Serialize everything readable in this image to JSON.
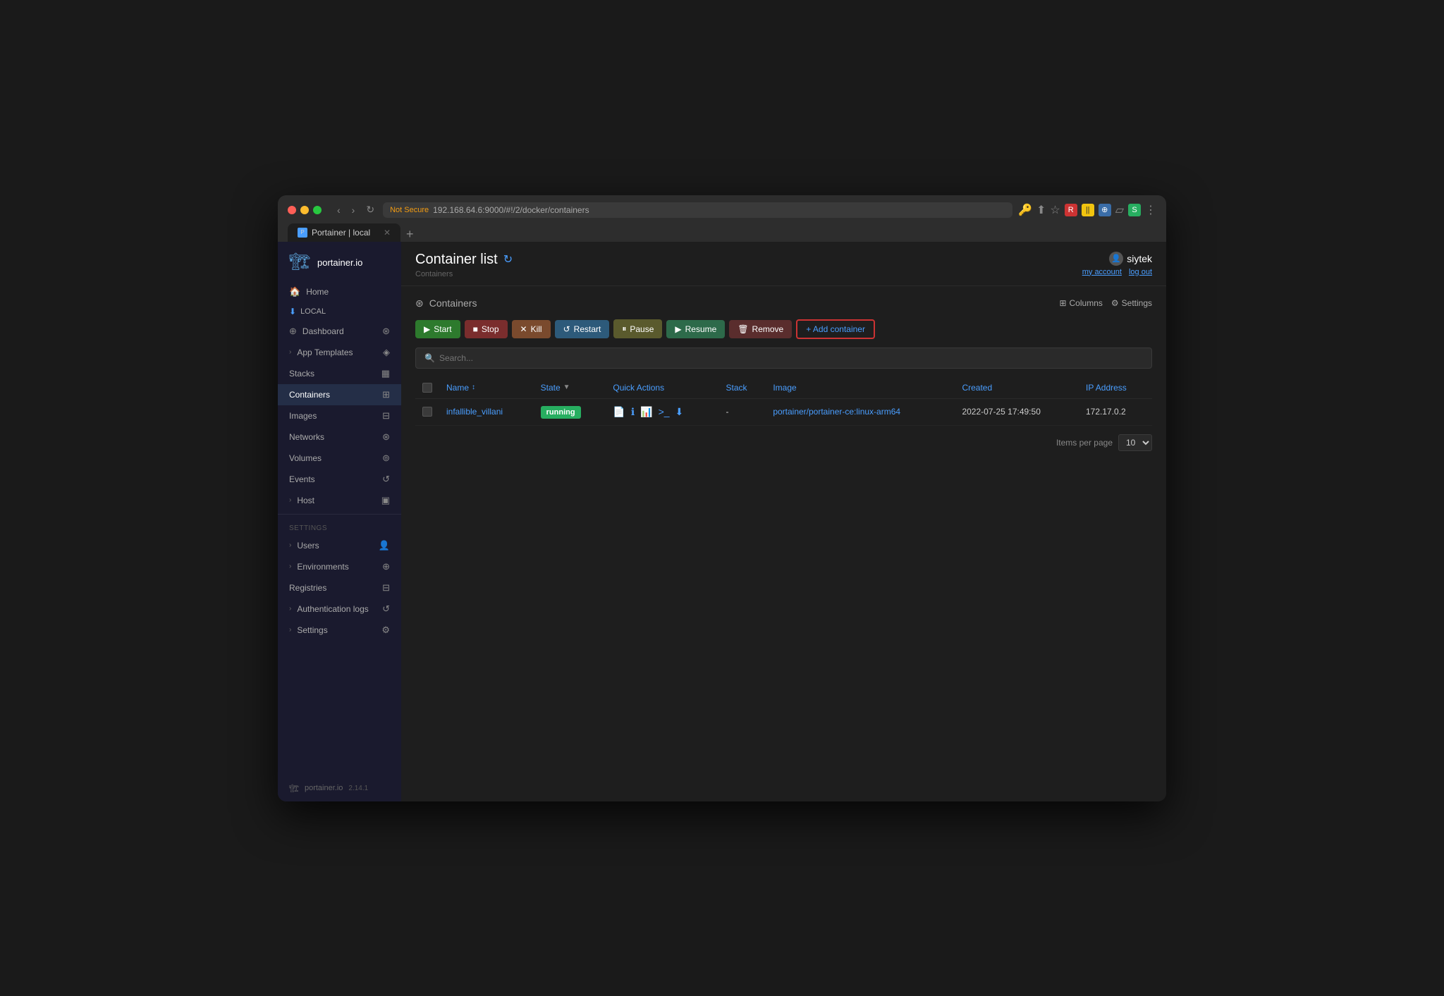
{
  "browser": {
    "tab_title": "Portainer | local",
    "tab_icon": "P",
    "url": "192.168.64.6:9000/#!/2/docker/containers",
    "url_full": "192.168.64.6:9000/#!/2/docker/containers",
    "security_warning": "Not Secure",
    "new_tab_label": "+"
  },
  "sidebar": {
    "logo_text": "portainer.io",
    "home_label": "Home",
    "local_label": "LOCAL",
    "nav_items": [
      {
        "id": "dashboard",
        "label": "Dashboard",
        "icon": "⊕"
      },
      {
        "id": "app-templates",
        "label": "App Templates",
        "icon": "◈",
        "has_chevron": true
      },
      {
        "id": "stacks",
        "label": "Stacks",
        "icon": "▦"
      },
      {
        "id": "containers",
        "label": "Containers",
        "icon": "⊞",
        "active": true
      },
      {
        "id": "images",
        "label": "Images",
        "icon": "⊟"
      },
      {
        "id": "networks",
        "label": "Networks",
        "icon": "⊛"
      },
      {
        "id": "volumes",
        "label": "Volumes",
        "icon": "⊚"
      },
      {
        "id": "events",
        "label": "Events",
        "icon": "↺"
      },
      {
        "id": "host",
        "label": "Host",
        "icon": "▣",
        "has_chevron": true
      }
    ],
    "settings_section": "SETTINGS",
    "settings_items": [
      {
        "id": "users",
        "label": "Users",
        "icon": "👤",
        "has_chevron": true
      },
      {
        "id": "environments",
        "label": "Environments",
        "icon": "⊕",
        "has_chevron": true
      },
      {
        "id": "registries",
        "label": "Registries",
        "icon": "⊟"
      },
      {
        "id": "auth-logs",
        "label": "Authentication logs",
        "icon": "↺",
        "has_chevron": true
      },
      {
        "id": "settings",
        "label": "Settings",
        "icon": "⚙",
        "has_chevron": true
      }
    ],
    "footer_logo": "portainer.io",
    "footer_version": "2.14.1"
  },
  "header": {
    "page_title": "Container list",
    "breadcrumb": "Containers",
    "user_name": "siytek",
    "my_account_label": "my account",
    "log_out_label": "log out"
  },
  "containers_section": {
    "section_title": "Containers",
    "columns_label": "Columns",
    "settings_label": "Settings"
  },
  "toolbar": {
    "start_label": "Start",
    "stop_label": "Stop",
    "kill_label": "Kill",
    "restart_label": "Restart",
    "pause_label": "Pause",
    "resume_label": "Resume",
    "remove_label": "Remove",
    "add_container_label": "+ Add container"
  },
  "search": {
    "placeholder": "Search..."
  },
  "table": {
    "columns": [
      {
        "id": "checkbox",
        "label": ""
      },
      {
        "id": "name",
        "label": "Name",
        "sortable": true
      },
      {
        "id": "state",
        "label": "State",
        "filterable": true
      },
      {
        "id": "quick-actions",
        "label": "Quick Actions"
      },
      {
        "id": "stack",
        "label": "Stack"
      },
      {
        "id": "image",
        "label": "Image"
      },
      {
        "id": "created",
        "label": "Created"
      },
      {
        "id": "ip-address",
        "label": "IP Address"
      }
    ],
    "rows": [
      {
        "name": "infallible_villani",
        "state": "running",
        "stack": "-",
        "image": "portainer/portainer-ce:linux-arm64",
        "created": "2022-07-25 17:49:50",
        "ip_address": "172.17.0.2"
      }
    ]
  },
  "pagination": {
    "items_per_page_label": "Items per page",
    "per_page_value": "10"
  }
}
